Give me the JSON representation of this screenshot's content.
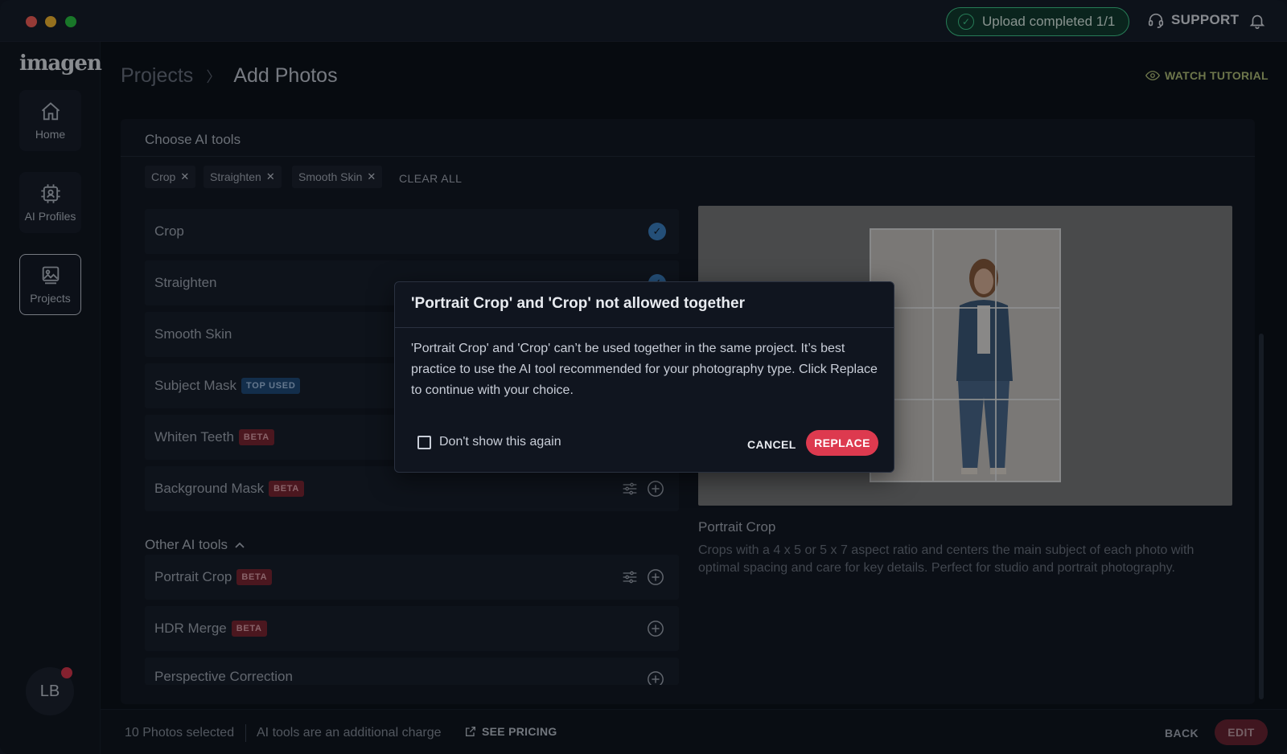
{
  "topbar": {
    "upload_status": "Upload completed 1/1",
    "support_label": "SUPPORT"
  },
  "sidebar": {
    "logo": "imagen",
    "items": [
      {
        "label": "Home",
        "icon": "home-icon"
      },
      {
        "label": "AI Profiles",
        "icon": "ai-profile-icon"
      },
      {
        "label": "Projects",
        "icon": "projects-icon",
        "active": true
      }
    ],
    "avatar_initials": "LB"
  },
  "header": {
    "breadcrumb_root": "Projects",
    "breadcrumb_separator": "〉",
    "page_title": "Add Photos",
    "watch_tutorial": "WATCH TUTORIAL"
  },
  "panel": {
    "title": "Choose AI tools",
    "chips": [
      "Crop",
      "Straighten",
      "Smooth Skin"
    ],
    "clear_all": "CLEAR ALL",
    "tools": [
      {
        "name": "Crop",
        "badge": "",
        "selected": true
      },
      {
        "name": "Straighten",
        "badge": "",
        "selected": true
      },
      {
        "name": "Smooth Skin",
        "badge": "",
        "selected": true
      },
      {
        "name": "Subject Mask",
        "badge": "TOP USED"
      },
      {
        "name": "Whiten Teeth",
        "badge": "BETA"
      },
      {
        "name": "Background Mask",
        "badge": "BETA"
      }
    ],
    "other_title": "Other AI tools",
    "other_tools": [
      {
        "name": "Portrait Crop",
        "badge": "BETA"
      },
      {
        "name": "HDR Merge",
        "badge": "BETA"
      },
      {
        "name": "Perspective Correction",
        "badge": ""
      }
    ],
    "preview": {
      "title": "Portrait Crop",
      "description": "Crops with a 4 x 5 or 5 x 7 aspect ratio and centers the main subject of each photo with optimal spacing and care for key details. Perfect for studio and portrait photography."
    }
  },
  "modal": {
    "title": "'Portrait Crop' and 'Crop' not allowed together",
    "body": "'Portrait Crop' and 'Crop' can’t be used together in the same project.  It’s best practice to use the AI tool recommended for your photography type.  Click Replace to continue with your choice.",
    "checkbox_label": "Don't show this again",
    "cancel_label": "CANCEL",
    "replace_label": "REPLACE"
  },
  "bottombar": {
    "selected_count": "10 Photos selected",
    "charge_note": "AI tools are an additional charge",
    "see_pricing": "SEE PRICING",
    "back_label": "BACK",
    "edit_label": "EDIT"
  },
  "colors": {
    "accent_red": "#dd3a4f",
    "success_green": "#3fcf8e",
    "check_blue": "#3c84c9",
    "tutorial_olive": "#b8c77a"
  }
}
